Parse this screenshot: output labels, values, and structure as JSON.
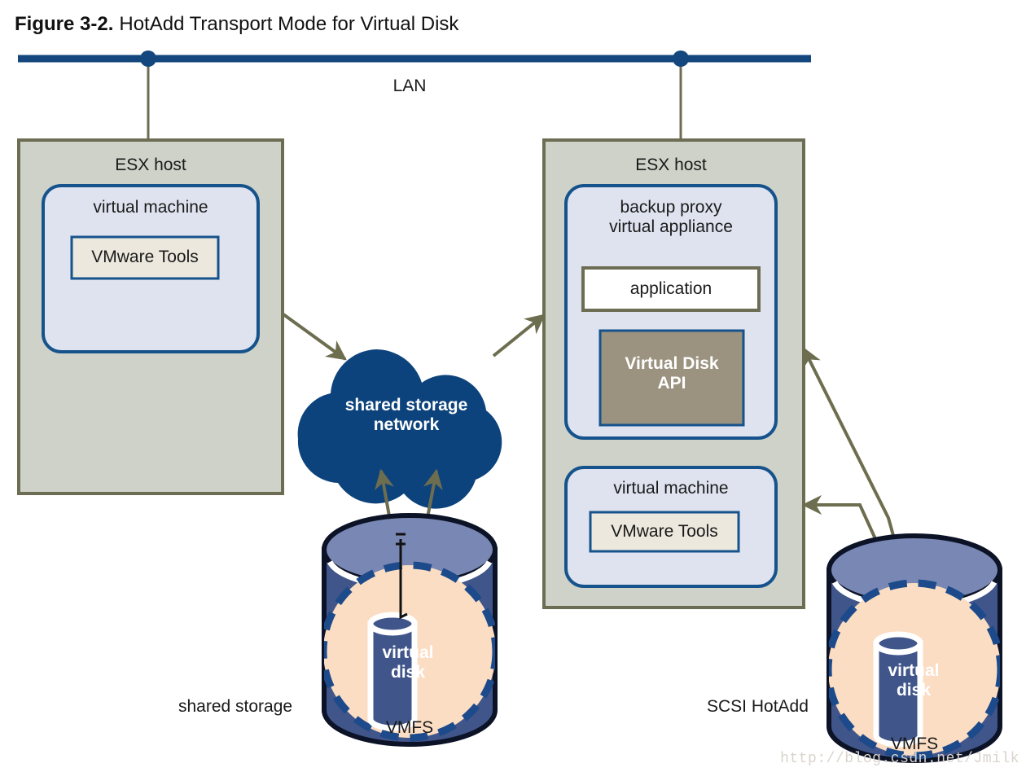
{
  "figure": {
    "number": "Figure 3-2.",
    "title": "HotAdd Transport Mode for Virtual Disk"
  },
  "network": {
    "lan_label": "LAN"
  },
  "hosts": [
    {
      "id": "esx-host-left",
      "label": "ESX host",
      "vm": {
        "label": "virtual machine",
        "tools_label": "VMware Tools"
      }
    },
    {
      "id": "esx-host-right",
      "label": "ESX host",
      "proxy": {
        "label": "backup proxy\nvirtual appliance",
        "application_label": "application",
        "api_label": "Virtual Disk\nAPI"
      },
      "vm": {
        "label": "virtual machine",
        "tools_label": "VMware Tools"
      }
    }
  ],
  "cloud": {
    "label": "shared storage\nnetwork"
  },
  "storage": [
    {
      "id": "shared-storage",
      "side_label": "shared storage",
      "fs_label": "VMFS",
      "disk_label": "virtual\ndisk"
    },
    {
      "id": "scsi-hotadd-storage",
      "side_label": "SCSI HotAdd",
      "fs_label": "VMFS",
      "disk_label": "virtual\ndisk"
    }
  ],
  "watermark": "http://blog.csdn.net/Jmilk",
  "colors": {
    "lan_blue": "#14477d",
    "host_fill": "#ced2c8",
    "host_stroke": "#6d6d54",
    "vm_fill": "#dee3ef",
    "vm_stroke": "#16538c",
    "tools_fill": "#ece8de",
    "app_fill": "#ffffff",
    "api_fill": "#9b9280",
    "cloud_fill": "#0d437c",
    "arrow": "#6d6d4f",
    "cyl_top": "#7987b4",
    "cyl_body": "#40558a",
    "cyl_outline": "#0d1326",
    "vmfs_fill": "#fbddc3",
    "vmfs_dash": "#1d4a8a"
  }
}
